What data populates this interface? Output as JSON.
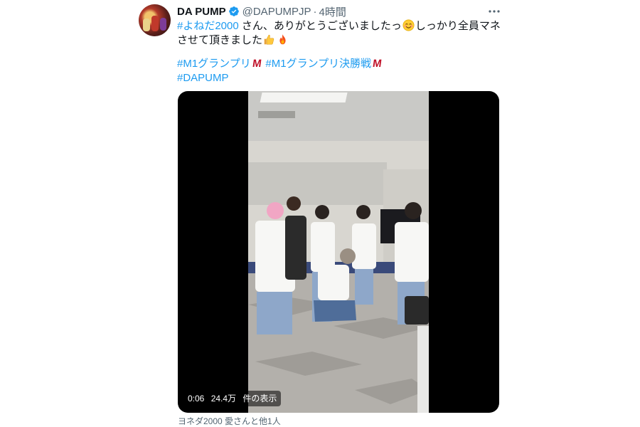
{
  "author": {
    "name": "DA PUMP",
    "handle": "@DAPUMPJP",
    "separator": "·",
    "time": "4時間"
  },
  "icons": {
    "verified": "verified-badge-icon",
    "more": "more-options-icon",
    "smile": "smiling-face-emoji",
    "thumbs": "thumbs-up-emoji",
    "fire": "fire-emoji",
    "m1_logo": "m1-logo-icon"
  },
  "colors": {
    "hashtag": "#1d9bf0",
    "verified": "#1d9bf0",
    "secondary_text": "#536471",
    "m1_logo": "#c0122a"
  },
  "tweet": {
    "hashtag1": "#よねだ2000",
    "text1": " さん、ありがとうございましたっ",
    "text2": "しっかり全員マネさせて頂きました",
    "tag_m1": "#M1グランプリ",
    "tag_m1_final": "#M1グランプリ決勝戦",
    "tag_dapump": "#DAPUMP",
    "m1_mark": "M"
  },
  "media": {
    "time": "0:06",
    "views": "24.4万",
    "views_label": "件の表示",
    "tagged": "ヨネダ2000 愛さんと他1人"
  }
}
